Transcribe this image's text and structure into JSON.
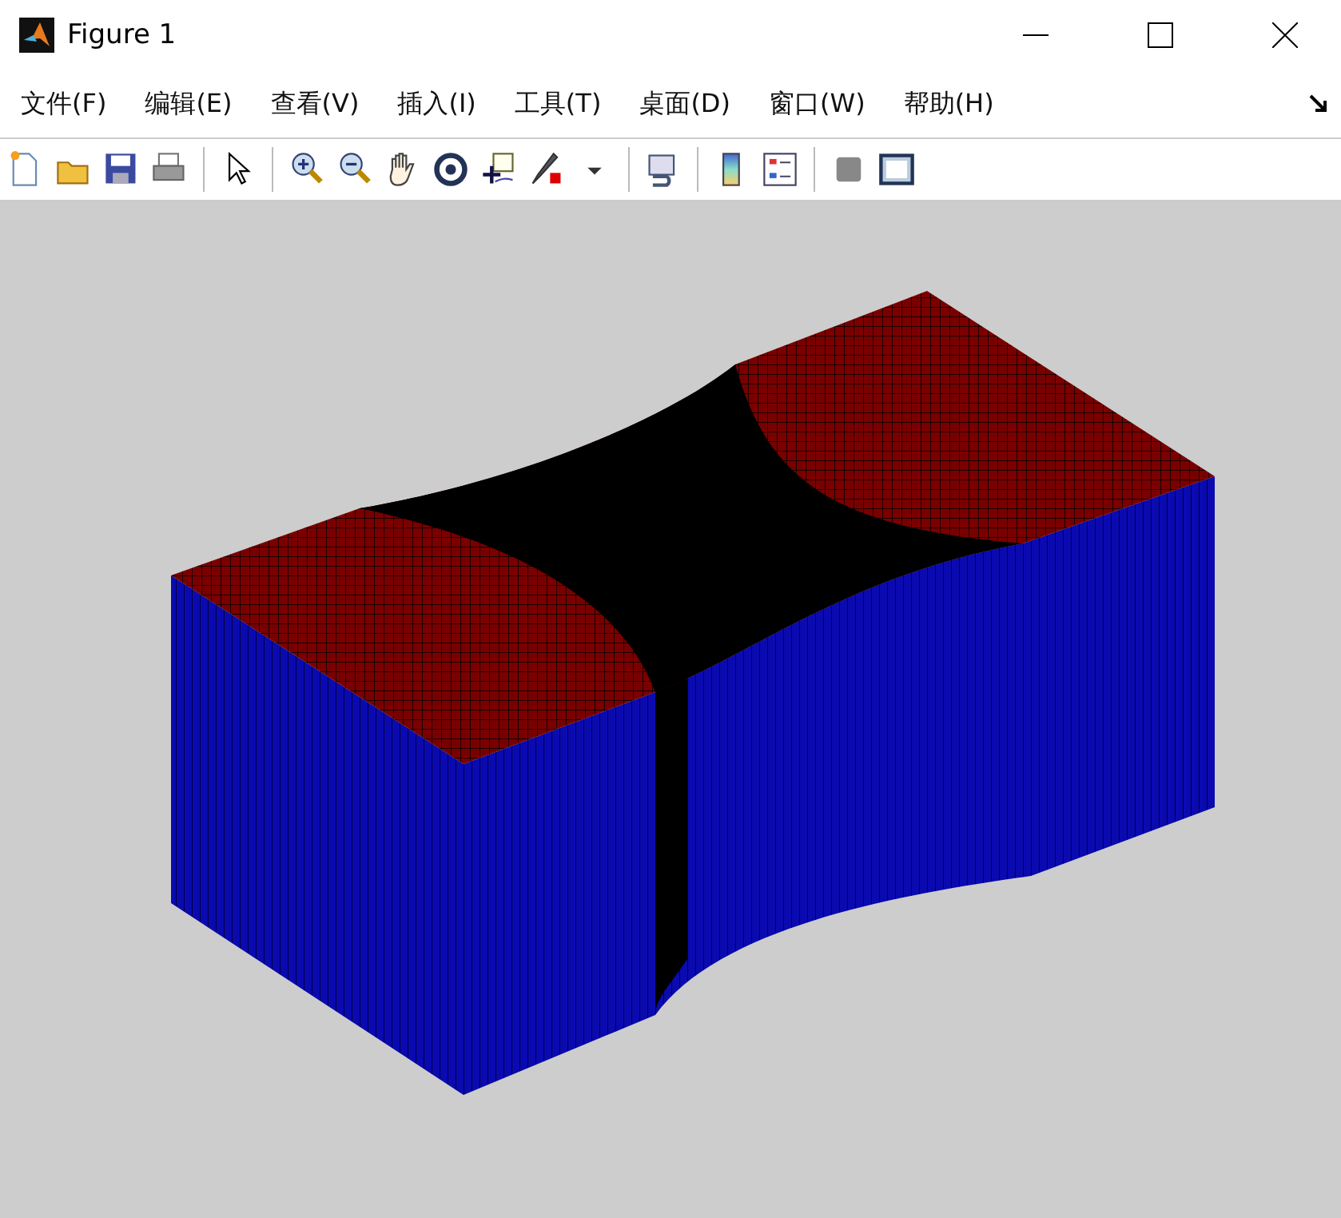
{
  "window": {
    "title": "Figure 1"
  },
  "menu": [
    {
      "label": "文件(F)"
    },
    {
      "label": "编辑(E)"
    },
    {
      "label": "查看(V)"
    },
    {
      "label": "插入(I)"
    },
    {
      "label": "工具(T)"
    },
    {
      "label": "桌面(D)"
    },
    {
      "label": "窗口(W)"
    },
    {
      "label": "帮助(H)"
    }
  ]
}
